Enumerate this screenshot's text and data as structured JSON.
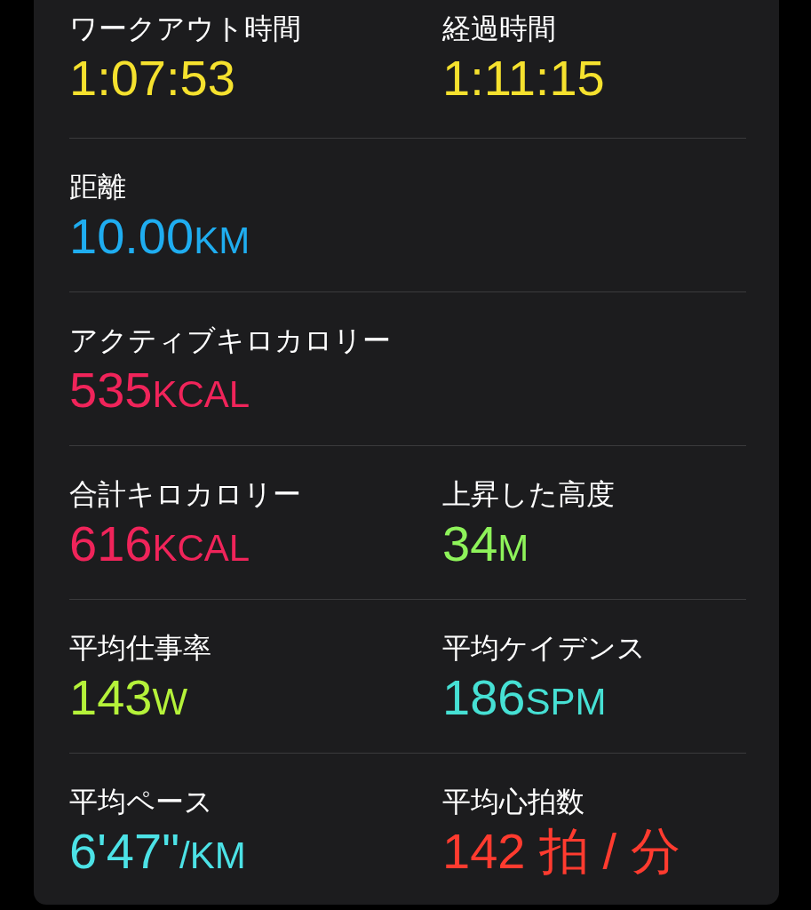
{
  "rows": [
    {
      "metrics": [
        {
          "label": "ワークアウト時間",
          "value": "1:07:53",
          "color": "#f5e12e"
        },
        {
          "label": "経過時間",
          "value": "1:11:15",
          "color": "#f5e12e"
        }
      ]
    },
    {
      "metrics": [
        {
          "label": "距離",
          "value": "10.00",
          "unit": "KM",
          "color": "#1fadf0"
        }
      ]
    },
    {
      "metrics": [
        {
          "label": "アクティブキロカロリー",
          "value": "535",
          "unit": "KCAL",
          "color": "#f0245a"
        }
      ]
    },
    {
      "metrics": [
        {
          "label": "合計キロカロリー",
          "value": "616",
          "unit": "KCAL",
          "color": "#f0245a"
        },
        {
          "label": "上昇した高度",
          "value": "34",
          "unit": "M",
          "color": "#8ef35a"
        }
      ]
    },
    {
      "metrics": [
        {
          "label": "平均仕事率",
          "value": "143",
          "unit": "W",
          "color": "#b5f23a"
        },
        {
          "label": "平均ケイデンス",
          "value": "186",
          "unit": "SPM",
          "color": "#46e0d4"
        }
      ]
    },
    {
      "metrics": [
        {
          "label": "平均ペース",
          "value": "6'47\"",
          "unit": "/KM",
          "color": "#4ce2e6"
        },
        {
          "label": "平均心拍数",
          "value": "142 拍 / 分",
          "color": "#ff3b2f"
        }
      ]
    }
  ]
}
